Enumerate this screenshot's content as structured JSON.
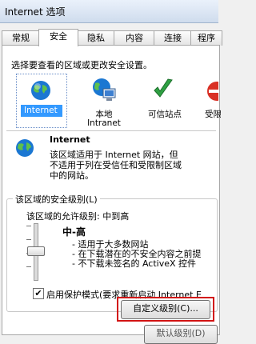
{
  "window": {
    "title": "Internet 选项"
  },
  "tabs": [
    "常规",
    "安全",
    "隐私",
    "内容",
    "连接",
    "程序"
  ],
  "instruction": "选择要查看的区域或更改安全设置。",
  "zones": [
    {
      "label": "Internet",
      "icon": "globe-icon"
    },
    {
      "label": "本地",
      "label2": "Intranet",
      "icon": "local-intranet-icon"
    },
    {
      "label": "可信站点",
      "icon": "trusted-sites-check-icon"
    },
    {
      "label": "受限",
      "icon": "restricted-sites-icon"
    }
  ],
  "zone_detail": {
    "name": "Internet",
    "description": [
      "该区域适用于 Internet 网站，但",
      "不适用于列在受信任和受限制区域",
      "中的网站。"
    ]
  },
  "security_level": {
    "group_title": "该区域的安全级别(L)",
    "allowed": "该区域的允许级别: 中到高",
    "level_name": "中-高",
    "bullets": [
      "- 适用于大多数网站",
      "- 在下载潜在的不安全内容之前提",
      "- 不下载未签名的 ActiveX 控件"
    ]
  },
  "protected_mode": {
    "label": "启用保护模式(要求重新启动 Internet E",
    "checked": "✔"
  },
  "buttons": {
    "custom_level": "自定义级别(C)...",
    "default_level": "默认级别(D)"
  },
  "colors": {
    "accent": "#3399ff",
    "highlight_box": "#d21414"
  }
}
